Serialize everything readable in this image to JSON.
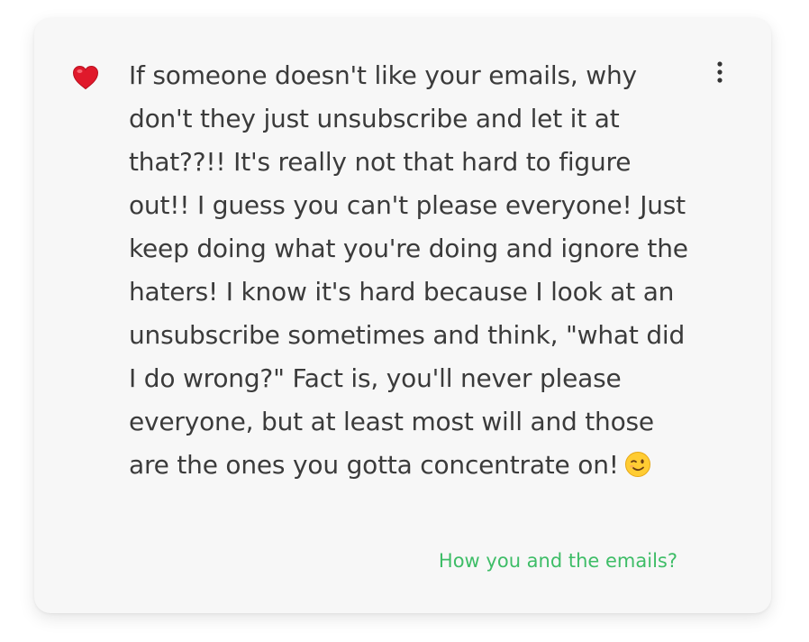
{
  "comment": {
    "reaction_icon": "heart-icon",
    "text": "If someone doesn't like your emails, why don't they just unsubscribe and let it at that??!! It's really not that hard to figure out!! I guess you can't please everyone! Just keep doing what you're doing and ignore the haters! I know it's hard because I look at an unsubscribe sometimes and think, \"what did I do wrong?\" Fact is, you'll never please everyone, but at least most will and those are the ones you gotta concentrate on!",
    "emoji_icon": "winking-face-icon",
    "menu_icon": "more-vertical-icon",
    "link_text": "How you and the emails?"
  },
  "colors": {
    "card_background": "#f7f7f7",
    "text": "#3b3b3b",
    "link": "#3ebd67",
    "heart": "#e0192b"
  }
}
